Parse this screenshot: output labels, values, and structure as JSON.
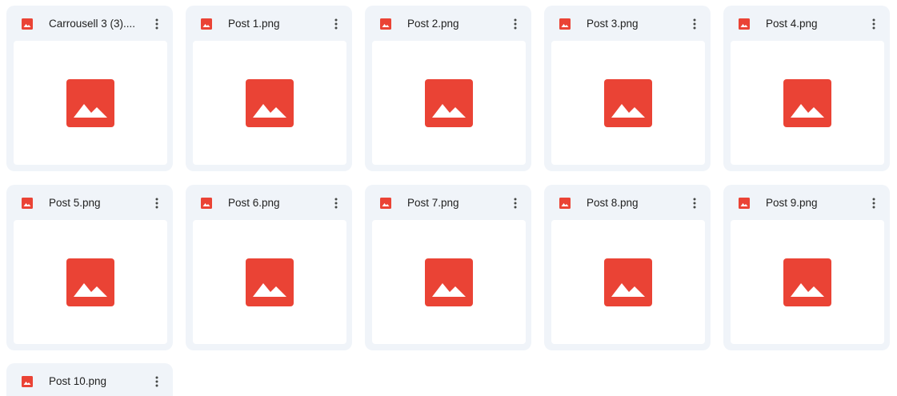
{
  "colors": {
    "card_background": "#f0f4f9",
    "preview_background": "#ffffff",
    "image_icon": "#ea4335",
    "text": "#1f1f1f",
    "more_icon": "#444746"
  },
  "icons": {
    "file_type": "image-icon",
    "thumbnail": "image-placeholder-icon",
    "more": "more-vert-icon"
  },
  "files": [
    {
      "name": "Carrousell 3 (3)...."
    },
    {
      "name": "Post 1.png"
    },
    {
      "name": "Post 2.png"
    },
    {
      "name": "Post 3.png"
    },
    {
      "name": "Post 4.png"
    },
    {
      "name": "Post 5.png"
    },
    {
      "name": "Post 6.png"
    },
    {
      "name": "Post 7.png"
    },
    {
      "name": "Post 8.png"
    },
    {
      "name": "Post 9.png"
    },
    {
      "name": "Post 10.png"
    }
  ]
}
